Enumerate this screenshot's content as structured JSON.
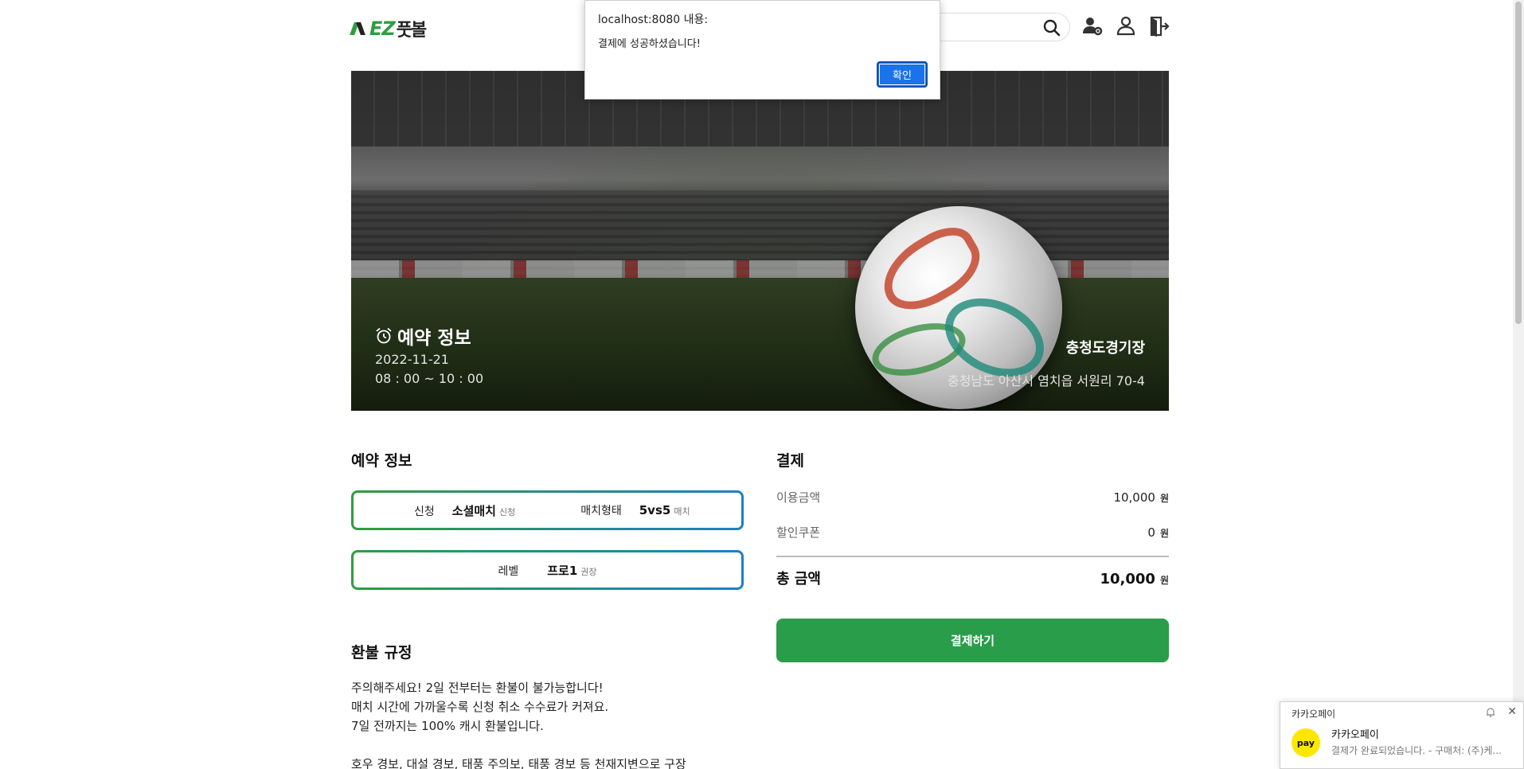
{
  "header": {
    "logo_text": "EZ풋볼",
    "logo_mark": "EZ",
    "logo_word": "풋볼"
  },
  "hero": {
    "title": "예약 정보",
    "date": "2022-11-21",
    "time": "08 : 00 ~ 10 : 00",
    "venue": "충청도경기장",
    "address": "충청남도 아산시 염치읍 서원리 70-4"
  },
  "reservation": {
    "title": "예약 정보",
    "apply_label": "신청",
    "apply_value": "소셜매치",
    "apply_unit": "신청",
    "match_type_label": "매치형태",
    "match_type_value": "5vs5",
    "match_type_unit": "매치",
    "level_label": "레벨",
    "level_value": "프로1",
    "level_unit": "권장"
  },
  "payment": {
    "title": "결제",
    "usage_label": "이용금액",
    "usage_amount": "10,000",
    "coupon_label": "할인쿠폰",
    "coupon_amount": "0",
    "total_label": "총 금액",
    "total_amount": "10,000",
    "currency": "원",
    "pay_button": "결제하기"
  },
  "refund": {
    "title": "환불 규정",
    "lines": [
      "주의해주세요! 2일 전부터는 환불이 불가능합니다!",
      "매치 시간에 가까울수록 신청 취소 수수료가 커져요.",
      "7일 전까지는 100% 캐시 환불입니다.",
      "",
      "호우 경보, 대설 경보, 태풍 주의보, 태풍 경보 등 천재지변으로 구장"
    ]
  },
  "dialog": {
    "title": "localhost:8080 내용:",
    "message": "결제에 성공하셨습니다!",
    "ok_button": "확인"
  },
  "toast": {
    "app": "카카오페이",
    "title": "카카오페이",
    "body": "결제가 완료되었습니다.  - 구매처: (주)케...",
    "logo_text": "pay"
  },
  "colors": {
    "brand_green": "#2a9d4a",
    "card_gradient_start": "#2e9e3f",
    "card_gradient_end": "#1f7fc4",
    "dialog_button": "#1a73e8",
    "kakao_yellow": "#ffe600"
  },
  "icons": [
    "search-icon",
    "user-settings-icon",
    "user-icon",
    "logout-icon",
    "alarm-clock-icon",
    "bell-icon",
    "close-icon"
  ]
}
